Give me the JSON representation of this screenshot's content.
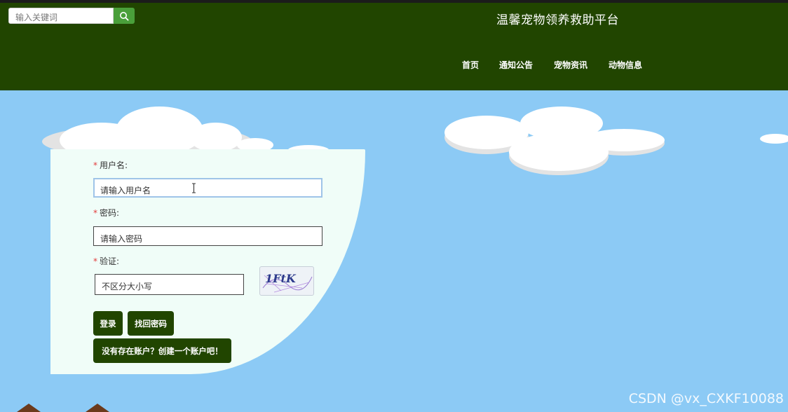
{
  "search": {
    "placeholder": "输入关键词"
  },
  "site": {
    "title": "温馨宠物领养救助平台"
  },
  "nav": {
    "items": [
      "首页",
      "通知公告",
      "宠物资讯",
      "动物信息"
    ]
  },
  "form": {
    "username_label": "用户名:",
    "username_value": "请输入用户名",
    "password_label": "密码:",
    "password_value": "请输入密码",
    "captcha_label": "验证:",
    "captcha_value": "不区分大小写",
    "captcha_text": "1FtK",
    "login_label": "登录",
    "recover_label": "找回密码",
    "register_label": "没有存在账户？创建一个账户吧！"
  },
  "watermark": "CSDN @vx_CXKF10088",
  "colors": {
    "header": "#214500",
    "sky": "#8ccaf5",
    "panel": "#f0fdf8",
    "search_button": "#4a9f3a",
    "required": "#e23b3b"
  }
}
